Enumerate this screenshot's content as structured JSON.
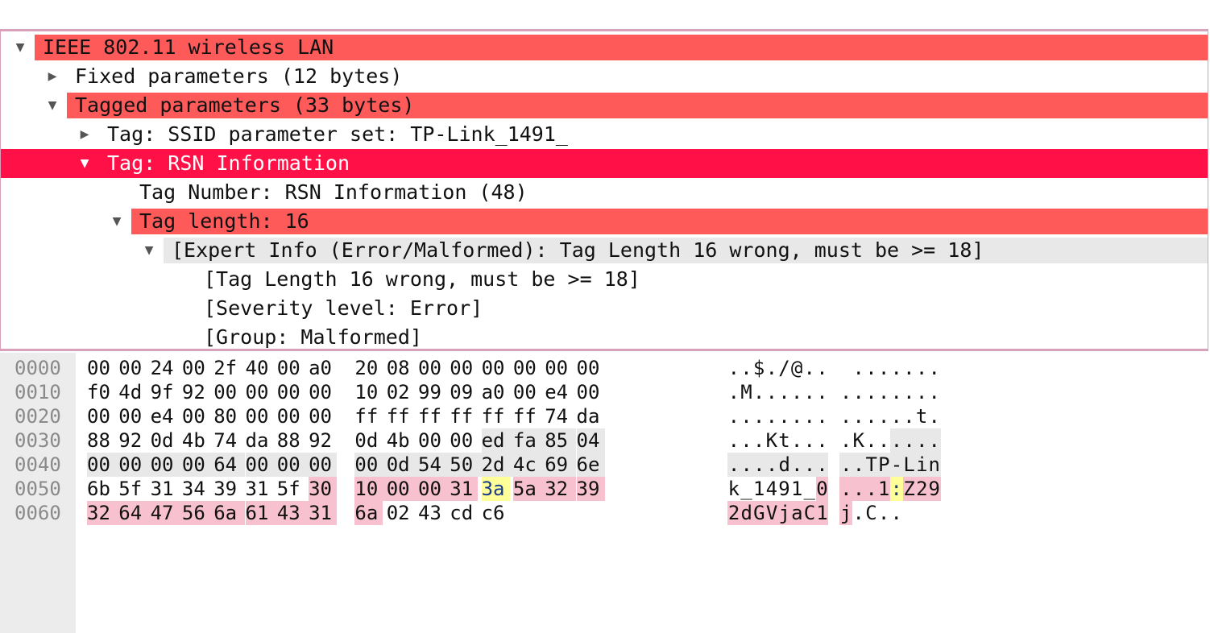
{
  "tree": [
    {
      "label": "IEEE 802.11 wireless LAN",
      "arrow": "▼",
      "indent": 0,
      "style": "red"
    },
    {
      "label": "Fixed parameters (12 bytes)",
      "arrow": "▶",
      "indent": 1,
      "style": ""
    },
    {
      "label": "Tagged parameters (33 bytes)",
      "arrow": "▼",
      "indent": 1,
      "style": "red"
    },
    {
      "label": "Tag: SSID parameter set: TP-Link_1491_",
      "arrow": "▶",
      "indent": 2,
      "style": ""
    },
    {
      "label": "Tag: RSN Information",
      "arrow": "▼",
      "indent": 2,
      "style": "sel"
    },
    {
      "label": "Tag Number: RSN Information (48)",
      "arrow": "",
      "indent": 3,
      "style": ""
    },
    {
      "label": "Tag length: 16",
      "arrow": "▼",
      "indent": 3,
      "style": "red"
    },
    {
      "label": "[Expert Info (Error/Malformed): Tag Length 16 wrong, must be >= 18]",
      "arrow": "▼",
      "indent": 4,
      "style": "gray"
    },
    {
      "label": "[Tag Length 16 wrong, must be >= 18]",
      "arrow": "",
      "indent": 5,
      "style": ""
    },
    {
      "label": "[Severity level: Error]",
      "arrow": "",
      "indent": 5,
      "style": ""
    },
    {
      "label": "[Group: Malformed]",
      "arrow": "",
      "indent": 5,
      "style": ""
    }
  ],
  "hex": [
    {
      "offset": "0000",
      "bytes": [
        "00",
        "00",
        "24",
        "00",
        "2f",
        "40",
        "00",
        "a0",
        "20",
        "08",
        "00",
        "00",
        "00",
        "00",
        "00",
        "00"
      ],
      "ascii": "..$./@..  ......."
    },
    {
      "offset": "0010",
      "bytes": [
        "f0",
        "4d",
        "9f",
        "92",
        "00",
        "00",
        "00",
        "00",
        "10",
        "02",
        "99",
        "09",
        "a0",
        "00",
        "e4",
        "00"
      ],
      "ascii": ".M...... ........"
    },
    {
      "offset": "0020",
      "bytes": [
        "00",
        "00",
        "e4",
        "00",
        "80",
        "00",
        "00",
        "00",
        "ff",
        "ff",
        "ff",
        "ff",
        "ff",
        "ff",
        "74",
        "da"
      ],
      "ascii": "........ ......t."
    },
    {
      "offset": "0030",
      "bytes": [
        "88",
        "92",
        "0d",
        "4b",
        "74",
        "da",
        "88",
        "92",
        "0d",
        "4b",
        "00",
        "00",
        "ed",
        "fa",
        "85",
        "04"
      ],
      "ascii": "...Kt... .K......"
    },
    {
      "offset": "0040",
      "bytes": [
        "00",
        "00",
        "00",
        "00",
        "64",
        "00",
        "00",
        "00",
        "00",
        "0d",
        "54",
        "50",
        "2d",
        "4c",
        "69",
        "6e"
      ],
      "ascii": "....d... ..TP-Lin"
    },
    {
      "offset": "0050",
      "bytes": [
        "6b",
        "5f",
        "31",
        "34",
        "39",
        "31",
        "5f",
        "30",
        "10",
        "00",
        "00",
        "31",
        "3a",
        "5a",
        "32",
        "39"
      ],
      "ascii": "k_1491_0 ...1:Z29"
    },
    {
      "offset": "0060",
      "bytes": [
        "32",
        "64",
        "47",
        "56",
        "6a",
        "61",
        "43",
        "31",
        "6a",
        "02",
        "43",
        "cd",
        "c6"
      ],
      "ascii": "2dGVjaC1 j.C.."
    }
  ],
  "colors": {
    "red": "#fe5a5a",
    "selected": "#ff1148",
    "gray": "#e8e8e8",
    "pink": "#f7c1cf",
    "yellow": "#ffff99"
  }
}
